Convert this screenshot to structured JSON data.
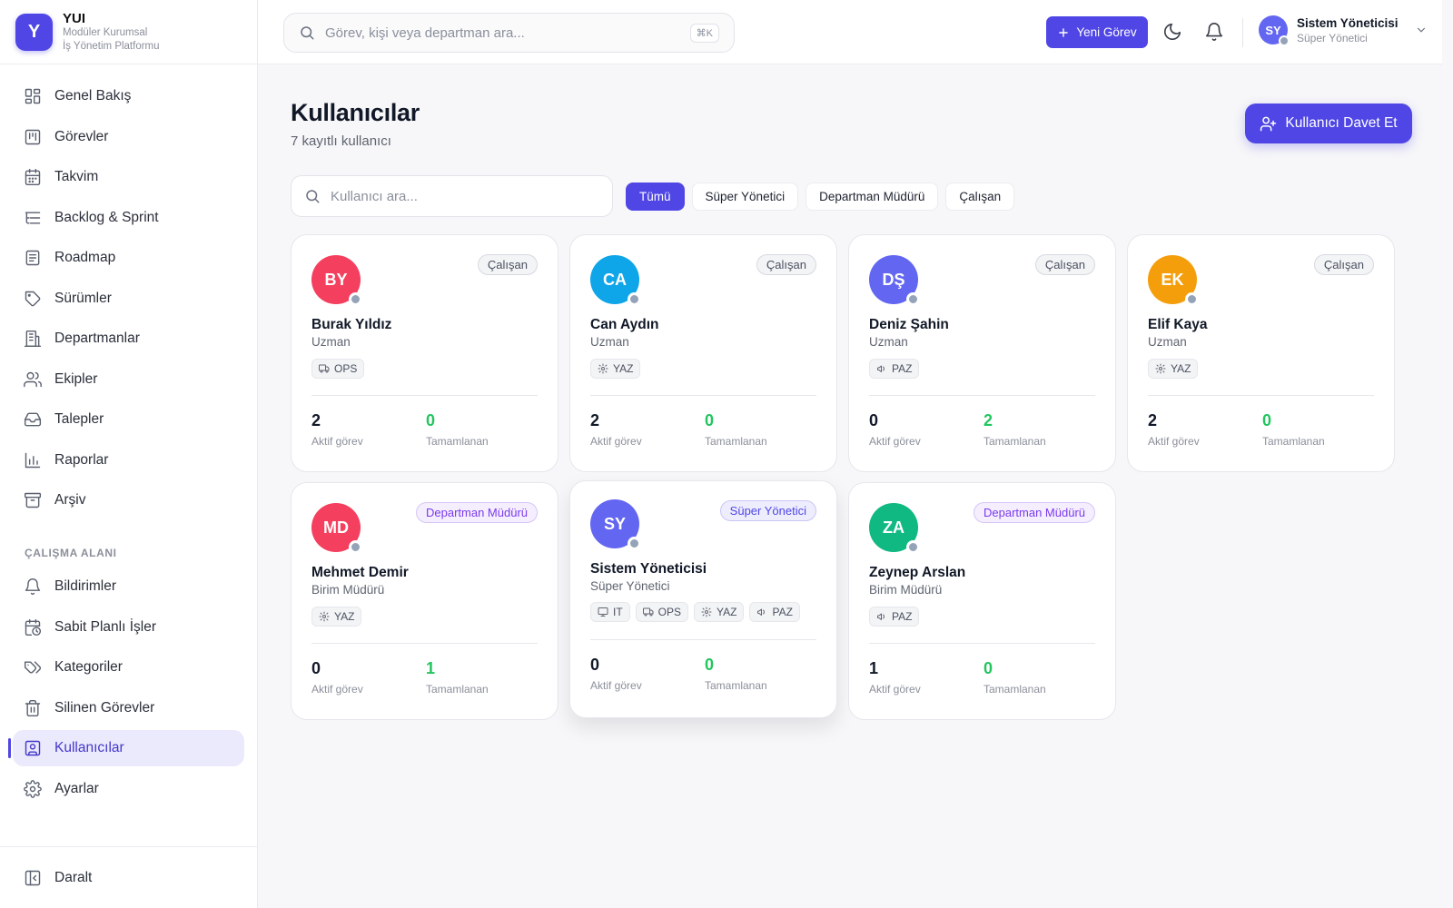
{
  "brand": {
    "logo_letter": "Y",
    "name": "YUI",
    "subtitle_line1": "Modüler Kurumsal",
    "subtitle_line2": "İş Yönetim Platformu"
  },
  "sidebar": {
    "items": [
      {
        "label": "Genel Bakış",
        "icon": "dashboard-icon"
      },
      {
        "label": "Görevler",
        "icon": "kanban-icon"
      },
      {
        "label": "Takvim",
        "icon": "calendar-icon"
      },
      {
        "label": "Backlog & Sprint",
        "icon": "list-tree-icon"
      },
      {
        "label": "Roadmap",
        "icon": "roadmap-icon"
      },
      {
        "label": "Sürümler",
        "icon": "tag-icon"
      },
      {
        "label": "Departmanlar",
        "icon": "building-icon"
      },
      {
        "label": "Ekipler",
        "icon": "users-icon"
      },
      {
        "label": "Talepler",
        "icon": "inbox-icon"
      },
      {
        "label": "Raporlar",
        "icon": "bar-chart-icon"
      },
      {
        "label": "Arşiv",
        "icon": "archive-icon"
      }
    ],
    "workspace_title": "ÇALIŞMA ALANI",
    "workspace_items": [
      {
        "label": "Bildirimler",
        "icon": "bell-icon"
      },
      {
        "label": "Sabit Planlı İşler",
        "icon": "calendar-clock-icon"
      },
      {
        "label": "Kategoriler",
        "icon": "tags-icon"
      },
      {
        "label": "Silinen Görevler",
        "icon": "trash-icon"
      },
      {
        "label": "Kullanıcılar",
        "icon": "user-square-icon",
        "active": true
      },
      {
        "label": "Ayarlar",
        "icon": "gear-icon"
      }
    ],
    "collapse_label": "Daralt"
  },
  "header": {
    "search_placeholder": "Görev, kişi veya departman ara...",
    "search_shortcut": "⌘K",
    "new_task_label": "Yeni Görev",
    "user": {
      "initials": "SY",
      "name": "Sistem Yöneticisi",
      "role": "Süper Yönetici"
    }
  },
  "page": {
    "title": "Kullanıcılar",
    "subtitle": "7 kayıtlı kullanıcı",
    "invite_label": "Kullanıcı Davet Et",
    "search_placeholder": "Kullanıcı ara...",
    "filters": [
      "Tümü",
      "Süper Yönetici",
      "Departman Müdürü",
      "Çalışan"
    ],
    "active_filter": "Tümü",
    "stat_labels": {
      "active": "Aktif görev",
      "done": "Tamamlanan"
    }
  },
  "users": [
    {
      "initials": "BY",
      "name": "Burak Yıldız",
      "title": "Uzman",
      "role": "Çalışan",
      "role_kind": "emp",
      "color": "#f43f5e",
      "depts": [
        {
          "code": "OPS",
          "icon": "truck-icon"
        }
      ],
      "active_tasks": "2",
      "completed": "0"
    },
    {
      "initials": "CA",
      "name": "Can Aydın",
      "title": "Uzman",
      "role": "Çalışan",
      "role_kind": "emp",
      "color": "#0ea5e9",
      "depts": [
        {
          "code": "YAZ",
          "icon": "cog-icon"
        }
      ],
      "active_tasks": "2",
      "completed": "0"
    },
    {
      "initials": "DŞ",
      "name": "Deniz Şahin",
      "title": "Uzman",
      "role": "Çalışan",
      "role_kind": "emp",
      "color": "#6366f1",
      "depts": [
        {
          "code": "PAZ",
          "icon": "megaphone-icon"
        }
      ],
      "active_tasks": "0",
      "completed": "2"
    },
    {
      "initials": "EK",
      "name": "Elif Kaya",
      "title": "Uzman",
      "role": "Çalışan",
      "role_kind": "emp",
      "color": "#f59e0b",
      "depts": [
        {
          "code": "YAZ",
          "icon": "cog-icon"
        }
      ],
      "active_tasks": "2",
      "completed": "0"
    },
    {
      "initials": "MD",
      "name": "Mehmet Demir",
      "title": "Birim Müdürü",
      "role": "Departman Müdürü",
      "role_kind": "mgr",
      "color": "#f43f5e",
      "depts": [
        {
          "code": "YAZ",
          "icon": "cog-icon"
        }
      ],
      "active_tasks": "0",
      "completed": "1"
    },
    {
      "initials": "SY",
      "name": "Sistem Yöneticisi",
      "title": "Süper Yönetici",
      "role": "Süper Yönetici",
      "role_kind": "sup",
      "color": "#6366f1",
      "depts": [
        {
          "code": "IT",
          "icon": "monitor-icon"
        },
        {
          "code": "OPS",
          "icon": "truck-icon"
        },
        {
          "code": "YAZ",
          "icon": "cog-icon"
        },
        {
          "code": "PAZ",
          "icon": "megaphone-icon"
        }
      ],
      "active_tasks": "0",
      "completed": "0"
    },
    {
      "initials": "ZA",
      "name": "Zeynep Arslan",
      "title": "Birim Müdürü",
      "role": "Departman Müdürü",
      "role_kind": "mgr",
      "color": "#10b981",
      "depts": [
        {
          "code": "PAZ",
          "icon": "megaphone-icon"
        }
      ],
      "active_tasks": "1",
      "completed": "0"
    }
  ],
  "colors": {
    "accent": "#4f46e5",
    "success": "#22c55e",
    "muted": "#8b8f9a",
    "presence_offline": "#94a3b8"
  }
}
